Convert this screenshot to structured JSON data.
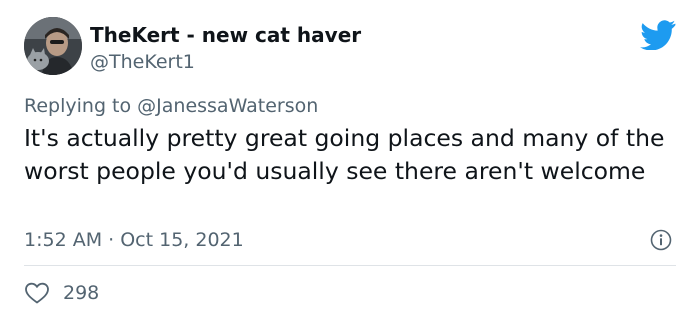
{
  "author": {
    "display_name": "TheKert - new cat haver",
    "handle": "@TheKert1"
  },
  "reply": {
    "prefix": "Replying to ",
    "mention": "@JanessaWaterson"
  },
  "tweet": {
    "text": "It's actually pretty great going places and many of the worst people you'd usually see there aren't welcome",
    "timestamp": "1:52 AM · Oct 15, 2021"
  },
  "engagement": {
    "likes": "298"
  },
  "icons": {
    "brand": "twitter-bird-icon",
    "info": "info-icon",
    "like": "heart-outline-icon"
  },
  "colors": {
    "brand_blue": "#1d9bf0",
    "text_primary": "#0f1419",
    "text_secondary": "#536471",
    "divider": "#dfe3e7"
  }
}
